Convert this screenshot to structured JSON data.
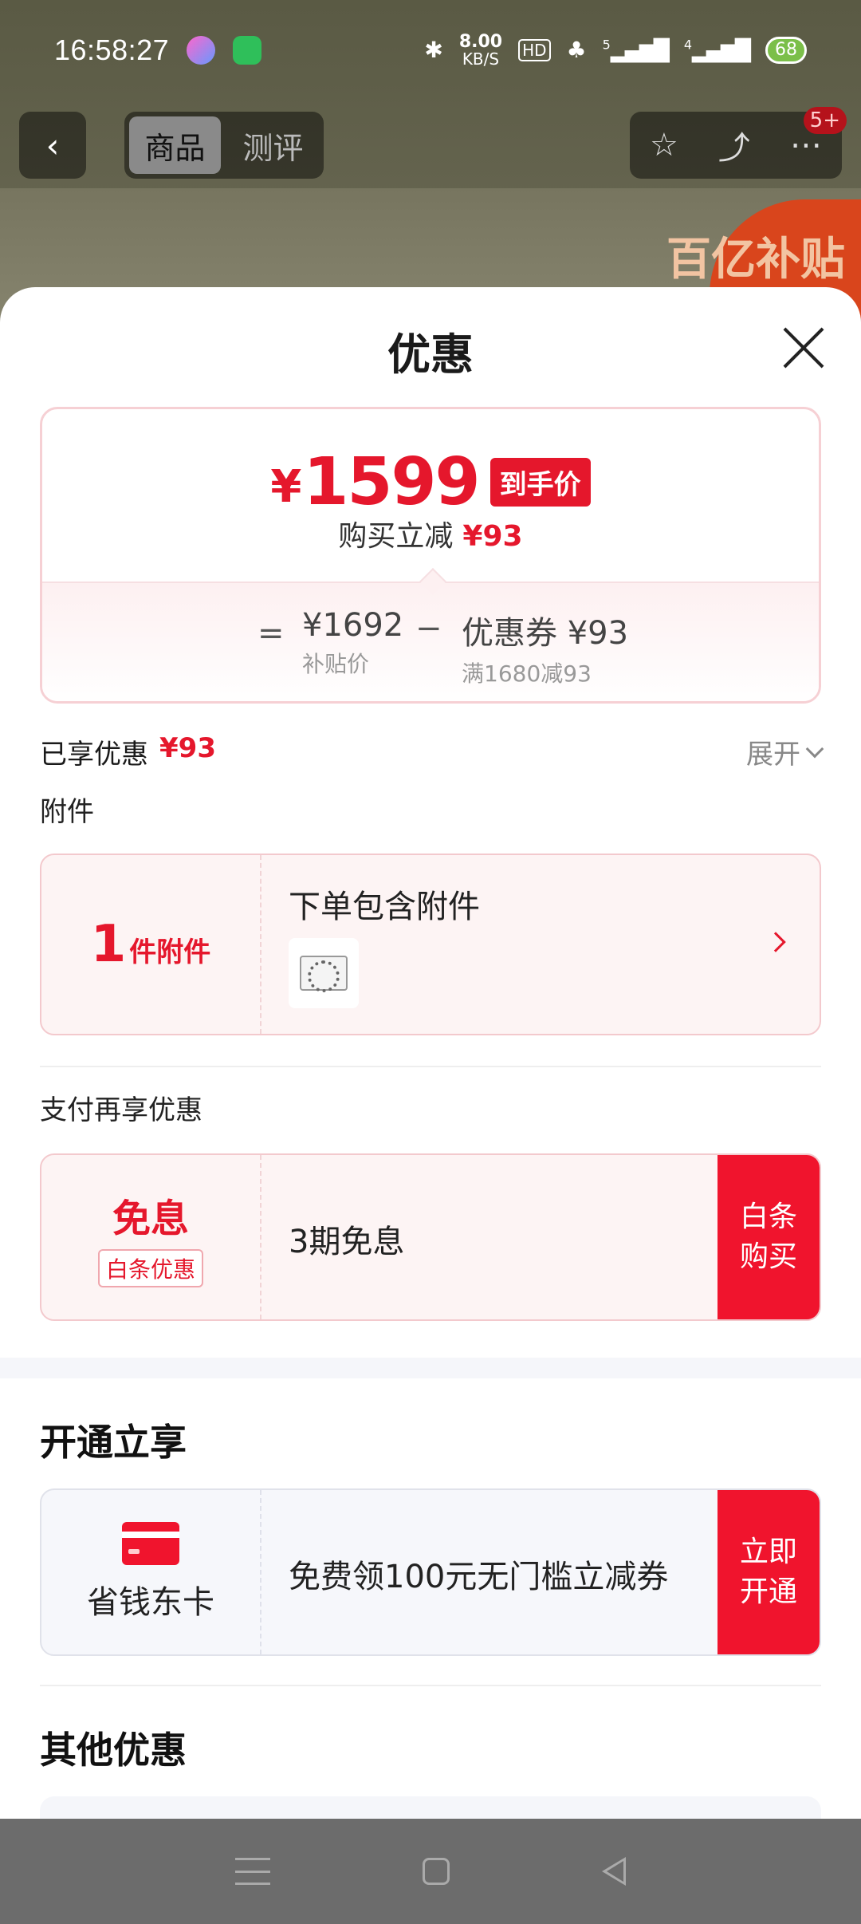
{
  "status_bar": {
    "time": "16:58:27",
    "net_speed": "8.00",
    "net_unit": "KB/S",
    "hd": "HD",
    "sim1": "5",
    "sim2": "4",
    "battery": "68"
  },
  "nav": {
    "tabs": [
      "商品",
      "测评"
    ],
    "badge": "5+"
  },
  "background": {
    "promo_text": "百亿补贴"
  },
  "sheet": {
    "title": "优惠",
    "price": {
      "currency": "¥",
      "value": "1599",
      "tag": "到手价",
      "reduce_label": "购买立减",
      "reduce_value": "¥93"
    },
    "calc": {
      "eq": "=",
      "base_value": "¥1692",
      "base_label": "补贴价",
      "minus": "−",
      "coupon_value": "优惠券 ¥93",
      "coupon_label": "满1680减93"
    },
    "enjoyed": {
      "label": "已享优惠",
      "value": "¥93",
      "expand": "展开"
    },
    "accessory": {
      "section": "附件",
      "count": "1",
      "unit": "件附件",
      "title": "下单包含附件"
    },
    "pay": {
      "section": "支付再享优惠",
      "badge_title": "免息",
      "badge_tag": "白条优惠",
      "body": "3期免息",
      "cta": "白条\n购买"
    },
    "open": {
      "section": "开通立享",
      "card_name": "省钱东卡",
      "body": "免费领100元无门槛立减券",
      "cta": "立即\n开通"
    },
    "other": {
      "section": "其他优惠"
    }
  }
}
